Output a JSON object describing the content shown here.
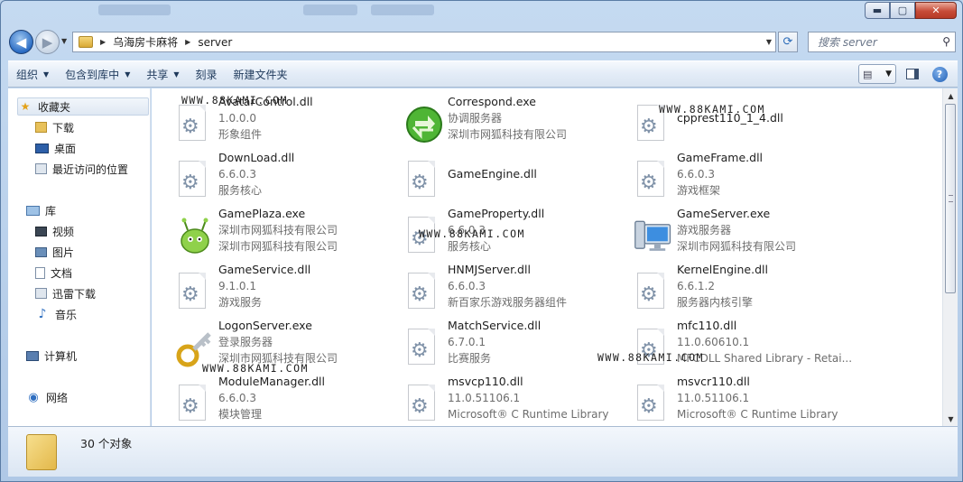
{
  "window": {
    "caption_buttons": {
      "minimize": "▬",
      "maximize": "▢",
      "close": "✕"
    }
  },
  "nav": {
    "breadcrumb": [
      "乌海房卡麻将",
      "server"
    ],
    "search_placeholder": "搜索 server"
  },
  "toolbar": {
    "items": [
      {
        "label": "组织",
        "dropdown": true
      },
      {
        "label": "包含到库中",
        "dropdown": true
      },
      {
        "label": "共享",
        "dropdown": true
      },
      {
        "label": "刻录",
        "dropdown": false
      },
      {
        "label": "新建文件夹",
        "dropdown": false
      }
    ]
  },
  "sidebar": {
    "items": [
      {
        "label": "收藏夹",
        "icon": "star-icon"
      },
      {
        "label": "下载",
        "icon": "download-folder-icon"
      },
      {
        "label": "桌面",
        "icon": "desktop-icon"
      },
      {
        "label": "最近访问的位置",
        "icon": "recent-places-icon"
      },
      {
        "label": "库",
        "icon": "library-icon"
      },
      {
        "label": "视频",
        "icon": "video-icon"
      },
      {
        "label": "图片",
        "icon": "picture-icon"
      },
      {
        "label": "文档",
        "icon": "document-icon"
      },
      {
        "label": "迅雷下载",
        "icon": "thunder-download-icon"
      },
      {
        "label": "音乐",
        "icon": "music-icon"
      },
      {
        "label": "计算机",
        "icon": "computer-icon"
      },
      {
        "label": "网络",
        "icon": "network-icon"
      }
    ]
  },
  "files": [
    {
      "name": "AvatarControl.dll",
      "line2": "1.0.0.0",
      "line3": "形象组件",
      "icon": "dll-icon"
    },
    {
      "name": "Correspond.exe",
      "line2": "协调服务器",
      "line3": "深圳市网狐科技有限公司",
      "icon": "green-arrows-icon"
    },
    {
      "name": "cpprest110_1_4.dll",
      "line2": "",
      "line3": "",
      "icon": "dll-icon"
    },
    {
      "name": "DownLoad.dll",
      "line2": "6.6.0.3",
      "line3": "服务核心",
      "icon": "dll-icon"
    },
    {
      "name": "GameEngine.dll",
      "line2": "",
      "line3": "",
      "icon": "dll-icon"
    },
    {
      "name": "GameFrame.dll",
      "line2": "6.6.0.3",
      "line3": "游戏框架",
      "icon": "dll-icon"
    },
    {
      "name": "GamePlaza.exe",
      "line2": "深圳市网狐科技有限公司",
      "line3": "深圳市网狐科技有限公司",
      "icon": "green-monster-icon"
    },
    {
      "name": "GameProperty.dll",
      "line2": "6.6.0.3",
      "line3": "服务核心",
      "icon": "dll-icon"
    },
    {
      "name": "GameServer.exe",
      "line2": "游戏服务器",
      "line3": "深圳市网狐科技有限公司",
      "icon": "computer-monitor-icon"
    },
    {
      "name": "GameService.dll",
      "line2": "9.1.0.1",
      "line3": "游戏服务",
      "icon": "dll-icon"
    },
    {
      "name": "HNMJServer.dll",
      "line2": "6.6.0.3",
      "line3": "新百家乐游戏服务器组件",
      "icon": "dll-icon"
    },
    {
      "name": "KernelEngine.dll",
      "line2": "6.6.1.2",
      "line3": "服务器内核引擎",
      "icon": "dll-icon"
    },
    {
      "name": "LogonServer.exe",
      "line2": "登录服务器",
      "line3": "深圳市网狐科技有限公司",
      "icon": "key-icon"
    },
    {
      "name": "MatchService.dll",
      "line2": "6.7.0.1",
      "line3": "比赛服务",
      "icon": "dll-icon"
    },
    {
      "name": "mfc110.dll",
      "line2": "11.0.60610.1",
      "line3": "MFCDLL Shared Library - Retai...",
      "icon": "dll-icon"
    },
    {
      "name": "ModuleManager.dll",
      "line2": "6.6.0.3",
      "line3": "模块管理",
      "icon": "dll-icon"
    },
    {
      "name": "msvcp110.dll",
      "line2": "11.0.51106.1",
      "line3": "Microsoft® C Runtime Library",
      "icon": "dll-icon"
    },
    {
      "name": "msvcr110.dll",
      "line2": "11.0.51106.1",
      "line3": "Microsoft® C Runtime Library",
      "icon": "dll-icon"
    }
  ],
  "watermarks": [
    "WWW.88KAMI.COM",
    "WWW.88KAMI.COM",
    "WWW.88KAMI.COM",
    "WWW.88KAMI.COM",
    "WWW.88KAMI.COM"
  ],
  "status": {
    "count_text": "30 个对象"
  }
}
